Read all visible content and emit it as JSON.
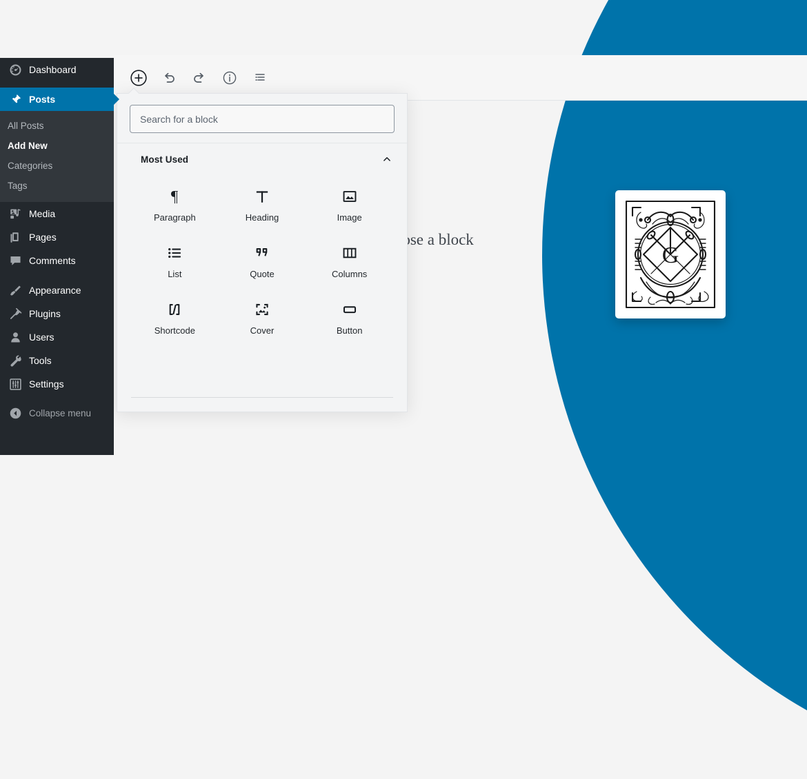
{
  "background": {
    "page_color": "#f4f4f4",
    "accent_color": "#0073aa",
    "circle_name": "decorative-blue-circle"
  },
  "sidebar": {
    "items": [
      {
        "label": "Dashboard",
        "icon": "dashboard-icon",
        "current": false
      },
      {
        "label": "Posts",
        "icon": "pin-icon",
        "current": true
      },
      {
        "label": "Media",
        "icon": "media-icon",
        "current": false
      },
      {
        "label": "Pages",
        "icon": "pages-icon",
        "current": false
      },
      {
        "label": "Comments",
        "icon": "comments-icon",
        "current": false
      },
      {
        "label": "Appearance",
        "icon": "brush-icon",
        "current": false
      },
      {
        "label": "Plugins",
        "icon": "plug-icon",
        "current": false
      },
      {
        "label": "Users",
        "icon": "user-icon",
        "current": false
      },
      {
        "label": "Tools",
        "icon": "wrench-icon",
        "current": false
      },
      {
        "label": "Settings",
        "icon": "sliders-icon",
        "current": false
      }
    ],
    "submenu": [
      {
        "label": "All Posts",
        "current": false
      },
      {
        "label": "Add New",
        "current": true
      },
      {
        "label": "Categories",
        "current": false
      },
      {
        "label": "Tags",
        "current": false
      }
    ],
    "collapse": {
      "label": "Collapse menu",
      "icon": "collapse-arrow-icon"
    }
  },
  "toolbar": {
    "buttons": [
      {
        "name": "add-block-button",
        "icon": "plus-circle-icon",
        "title": "Add block"
      },
      {
        "name": "undo-button",
        "icon": "undo-icon",
        "title": "Undo"
      },
      {
        "name": "redo-button",
        "icon": "redo-icon",
        "title": "Redo"
      },
      {
        "name": "content-info-button",
        "icon": "info-circle-icon",
        "title": "Content structure"
      },
      {
        "name": "block-navigation-button",
        "icon": "list-view-icon",
        "title": "Block navigation"
      }
    ]
  },
  "inserter": {
    "search": {
      "placeholder": "Search for a block",
      "value": ""
    },
    "panel": {
      "title": "Most Used",
      "expanded": true,
      "chevron_icon": "chevron-up-icon"
    },
    "blocks": [
      {
        "label": "Paragraph",
        "icon": "paragraph-icon"
      },
      {
        "label": "Heading",
        "icon": "heading-icon"
      },
      {
        "label": "Image",
        "icon": "image-icon"
      },
      {
        "label": "List",
        "icon": "list-icon"
      },
      {
        "label": "Quote",
        "icon": "quote-icon"
      },
      {
        "label": "Columns",
        "icon": "columns-icon"
      },
      {
        "label": "Shortcode",
        "icon": "shortcode-icon"
      },
      {
        "label": "Cover",
        "icon": "cover-icon"
      },
      {
        "label": "Button",
        "icon": "button-icon"
      }
    ]
  },
  "canvas": {
    "placeholder_text": "Choose a block"
  },
  "logo_card": {
    "letter": "G",
    "name": "gutenberg-logo-card"
  }
}
